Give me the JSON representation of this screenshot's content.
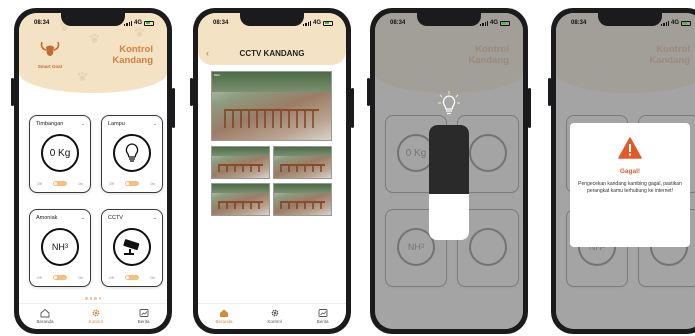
{
  "status": {
    "time": "08:34",
    "network": "4G"
  },
  "screen1": {
    "logo_text": "Smart Goat",
    "title_line1": "Kontrol",
    "title_line2": "Kandang",
    "cards": [
      {
        "label": "Timbangan",
        "value": "0 Kg",
        "off": "Off",
        "on": "On"
      },
      {
        "label": "Lampu",
        "value": "",
        "off": "Off",
        "on": "On"
      },
      {
        "label": "Amoniak",
        "value": "NH3",
        "off": "Off",
        "on": "On"
      },
      {
        "label": "CCTV",
        "value": "",
        "off": "Off",
        "on": "On"
      }
    ]
  },
  "screen2": {
    "title": "CCTV KANDANG",
    "cam_label": "REC"
  },
  "screen3": {
    "brightness_level": 0.4
  },
  "screen4": {
    "dialog_title": "Gagal!",
    "dialog_message": "Pengecekan kandang kambing gagal, pastikan perangkat kamu terhubung ke internet!"
  },
  "nav": [
    {
      "label": "Beranda",
      "icon": "home-icon"
    },
    {
      "label": "Kontrol",
      "icon": "gear-icon"
    },
    {
      "label": "Berita",
      "icon": "news-icon"
    }
  ],
  "colors": {
    "accent": "#d68a3d",
    "header_bg": "#f3e2c3",
    "alert": "#e05a2b"
  }
}
